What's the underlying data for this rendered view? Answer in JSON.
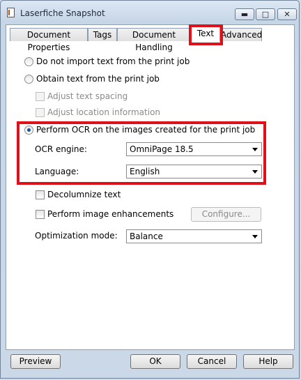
{
  "window": {
    "title": "Laserfiche Snapshot"
  },
  "tabs": [
    "Document Properties",
    "Tags",
    "Document Handling",
    "Text",
    "Advanced"
  ],
  "text_tab": {
    "do_not_import": "Do not import text from the print job",
    "obtain_text": "Obtain text from the print job",
    "adjust_spacing": "Adjust text spacing",
    "adjust_location": "Adjust location information",
    "perform_ocr": "Perform OCR on the images created for the print job",
    "ocr_engine_label": "OCR engine:",
    "ocr_engine_value": "OmniPage 18.5",
    "language_label": "Language:",
    "language_value": "English",
    "decolumnize": "Decolumnize text",
    "image_enhancements": "Perform image enhancements",
    "configure_button": "Configure...",
    "optimization_label": "Optimization mode:",
    "optimization_value": "Balance"
  },
  "buttons": {
    "preview": "Preview",
    "ok": "OK",
    "cancel": "Cancel",
    "help": "Help"
  },
  "accent_color": "#e0101a"
}
